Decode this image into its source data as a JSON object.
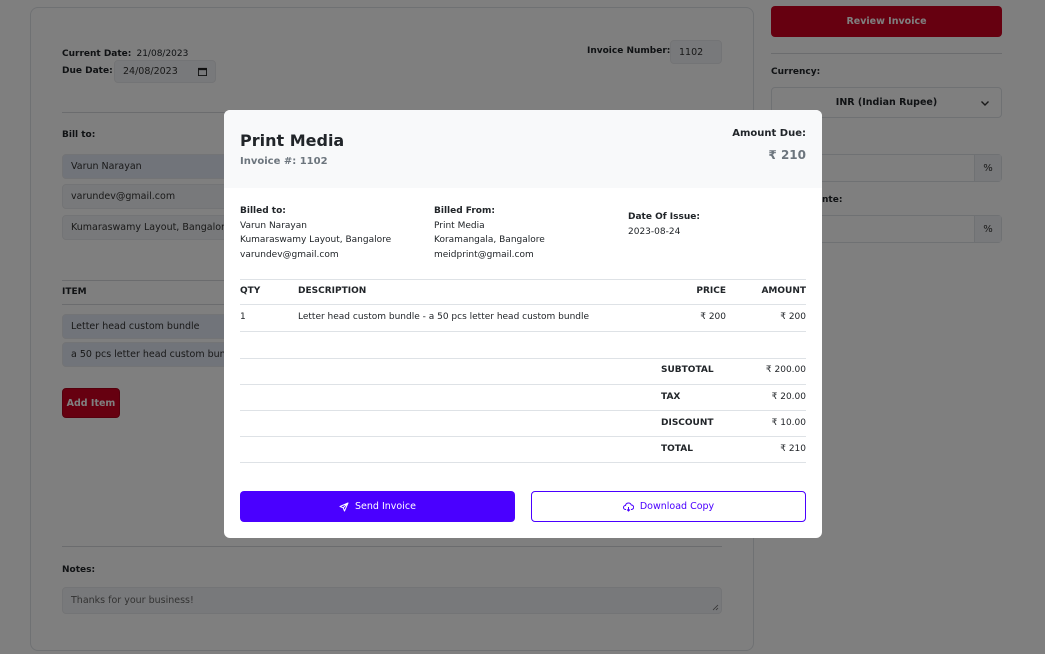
{
  "form": {
    "current_date_label": "Current Date:",
    "current_date_value": "21/08/2023",
    "due_date_label": "Due Date:",
    "due_date_value": "24/08/2023",
    "invoice_number_label": "Invoice Number:",
    "invoice_number_value": "1102",
    "bill_to_label": "Bill to:",
    "bill_to_name": "Varun Narayan",
    "bill_to_email": "varundev@gmail.com",
    "bill_to_address": "Kumaraswamy Layout, Bangalore",
    "item_header": "ITEM",
    "item_name": "Letter head custom bundle",
    "item_description": "a 50 pcs letter head custom bundle",
    "add_item_label": "Add Item",
    "notes_label": "Notes:",
    "notes_value": "Thanks for your business!"
  },
  "sidebar": {
    "review_label": "Review Invoice",
    "currency_label": "Currency:",
    "currency_value": "INR (Indian Rupee)",
    "discount_label_partial": "nte:",
    "percent_symbol": "%"
  },
  "modal": {
    "company": "Print Media",
    "invoice_no": "Invoice #: 1102",
    "amount_due_label": "Amount Due:",
    "amount_due_value": "₹ 210",
    "billed_to_label": "Billed to:",
    "billed_to_name": "Varun Narayan",
    "billed_to_address": "Kumaraswamy Layout, Bangalore",
    "billed_to_email": "varundev@gmail.com",
    "billed_from_label": "Billed From:",
    "billed_from_name": "Print Media",
    "billed_from_address": "Koramangala, Bangalore",
    "billed_from_email": "meidprint@gmail.com",
    "date_issue_label": "Date Of Issue:",
    "date_issue_value": "2023-08-24",
    "columns": {
      "qty": "QTY",
      "description": "DESCRIPTION",
      "price": "PRICE",
      "amount": "AMOUNT"
    },
    "row": {
      "qty": "1",
      "description": "Letter head custom bundle - a 50 pcs letter head custom bundle",
      "price": "₹ 200",
      "amount": "₹ 200"
    },
    "totals": {
      "subtotal_label": "SUBTOTAL",
      "subtotal_value": "₹ 200.00",
      "tax_label": "TAX",
      "tax_value": "₹ 20.00",
      "discount_label": "DISCOUNT",
      "discount_value": "₹ 10.00",
      "total_label": "TOTAL",
      "total_value": "₹ 210"
    },
    "send_label": "Send Invoice",
    "download_label": "Download Copy"
  },
  "colors": {
    "brand_red": "#cc0020",
    "primary": "#4a00ff"
  }
}
